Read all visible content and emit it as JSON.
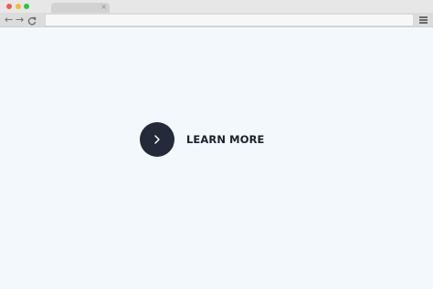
{
  "browser": {
    "tab": {
      "close_glyph": "×"
    },
    "nav": {
      "back": "←",
      "forward": "→",
      "reload": "C"
    },
    "address": {
      "value": ""
    },
    "menu_icon": "hamburger-menu-icon",
    "traffic_lights": {
      "close": "#f45a4d",
      "minimize": "#f5bc2e",
      "zoom": "#27c840"
    }
  },
  "page": {
    "background": "#f3f8fc",
    "cta": {
      "label": "LEARN MORE",
      "icon": "chevron-right-icon",
      "circle_color": "#252a3a"
    }
  }
}
